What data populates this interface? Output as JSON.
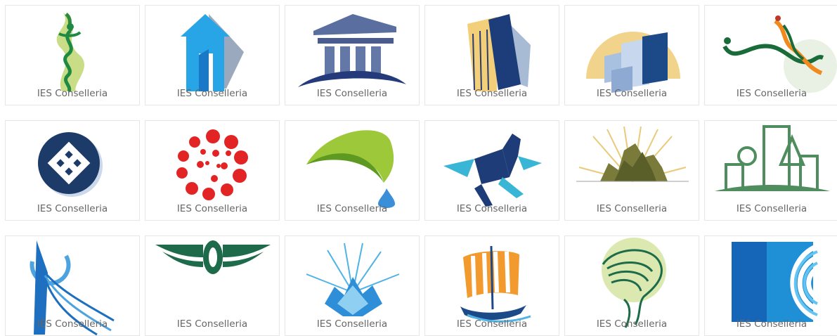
{
  "grid": {
    "items": [
      {
        "label": "IES Conselleria",
        "icon": "caduceus-flame-icon"
      },
      {
        "label": "IES Conselleria",
        "icon": "blue-house-door-icon"
      },
      {
        "label": "IES Conselleria",
        "icon": "classical-temple-icon"
      },
      {
        "label": "IES Conselleria",
        "icon": "tall-building-icon"
      },
      {
        "label": "IES Conselleria",
        "icon": "city-blocks-sun-icon"
      },
      {
        "label": "IES Conselleria",
        "icon": "snake-dna-icon"
      },
      {
        "label": "IES Conselleria",
        "icon": "interlaced-knot-badge-icon"
      },
      {
        "label": "IES Conselleria",
        "icon": "red-dot-spiral-icon"
      },
      {
        "label": "IES Conselleria",
        "icon": "green-leaf-drop-icon"
      },
      {
        "label": "IES Conselleria",
        "icon": "geometric-horse-icon"
      },
      {
        "label": "IES Conselleria",
        "icon": "crystal-city-rays-icon"
      },
      {
        "label": "IES Conselleria",
        "icon": "green-skyline-icon"
      },
      {
        "label": "IES Conselleria",
        "icon": "comet-orbit-icon"
      },
      {
        "label": "IES Conselleria",
        "icon": "winged-tire-icon"
      },
      {
        "label": "IES Conselleria",
        "icon": "blue-crystal-burst-icon"
      },
      {
        "label": "IES Conselleria",
        "icon": "viking-ship-icon"
      },
      {
        "label": "IES Conselleria",
        "icon": "green-line-head-icon"
      },
      {
        "label": "IES Conselleria",
        "icon": "blue-arcs-square-icon"
      }
    ]
  },
  "colors": {
    "card_border": "#e6e6e6",
    "label_text": "#666666"
  }
}
